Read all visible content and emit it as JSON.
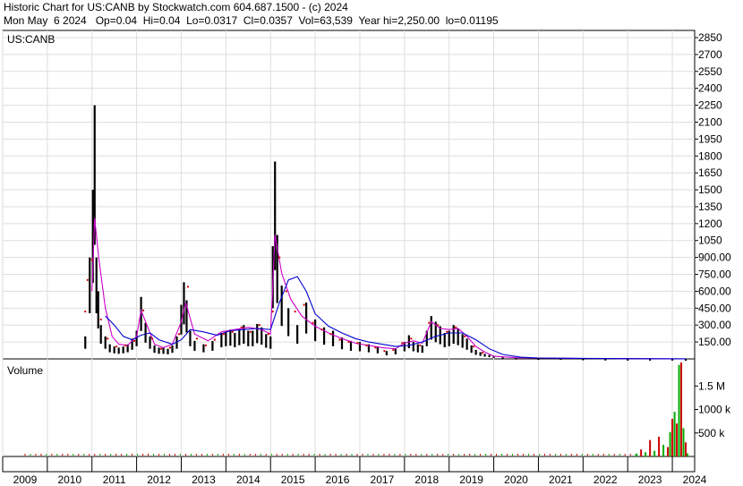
{
  "header": {
    "title": "Historic Chart for US:CANB by Stockwatch.com 604.687.1500 - (c) 2024",
    "summary": "Mon May  6 2024   Op=0.04  Hi=0.04  Lo=0.0317  Cl=0.0357  Vol=63,539  Year hi=2,250.00  lo=0.01195"
  },
  "chart_data": [
    {
      "type": "line",
      "panel_label": "US:CANB",
      "x_tick_labels": [
        "2009",
        "2010",
        "2011",
        "2012",
        "2013",
        "2014",
        "2015",
        "2016",
        "2017",
        "2018",
        "2019",
        "2020",
        "2021",
        "2022",
        "2023",
        "2024"
      ],
      "y_tick_labels": [
        "2850",
        "2700",
        "2550",
        "2400",
        "2250",
        "2100",
        "1950",
        "1800",
        "1650",
        "1500",
        "1350",
        "1200",
        "1050",
        "900.00",
        "750.00",
        "600.00",
        "450.00",
        "300.00",
        "150.00"
      ],
      "y_axis_side": "right",
      "ylim": [
        0,
        2850
      ],
      "grid": true,
      "series": [
        {
          "style": "price-bars",
          "color": "#000000",
          "points": [
            [
              2010.85,
              200
            ],
            [
              2010.95,
              900
            ],
            [
              2011.02,
              1500
            ],
            [
              2011.06,
              2250
            ],
            [
              2011.1,
              900
            ],
            [
              2011.14,
              600
            ],
            [
              2011.2,
              300
            ],
            [
              2011.3,
              200
            ],
            [
              2011.4,
              130
            ],
            [
              2011.5,
              110
            ],
            [
              2011.6,
              100
            ],
            [
              2011.7,
              110
            ],
            [
              2011.8,
              130
            ],
            [
              2011.9,
              180
            ],
            [
              2012.0,
              250
            ],
            [
              2012.1,
              550
            ],
            [
              2012.2,
              320
            ],
            [
              2012.3,
              200
            ],
            [
              2012.4,
              120
            ],
            [
              2012.5,
              100
            ],
            [
              2012.6,
              100
            ],
            [
              2012.7,
              90
            ],
            [
              2012.8,
              120
            ],
            [
              2012.9,
              200
            ],
            [
              2013.0,
              480
            ],
            [
              2013.06,
              680
            ],
            [
              2013.12,
              520
            ],
            [
              2013.2,
              250
            ],
            [
              2013.3,
              160
            ],
            [
              2013.5,
              130
            ],
            [
              2013.7,
              160
            ],
            [
              2013.9,
              230
            ],
            [
              2014.0,
              250
            ],
            [
              2014.1,
              260
            ],
            [
              2014.2,
              230
            ],
            [
              2014.3,
              270
            ],
            [
              2014.4,
              300
            ],
            [
              2014.5,
              250
            ],
            [
              2014.6,
              250
            ],
            [
              2014.7,
              310
            ],
            [
              2014.8,
              280
            ],
            [
              2014.9,
              220
            ],
            [
              2015.0,
              200
            ],
            [
              2015.05,
              1000
            ],
            [
              2015.1,
              1750
            ],
            [
              2015.15,
              1100
            ],
            [
              2015.25,
              650
            ],
            [
              2015.4,
              450
            ],
            [
              2015.6,
              300
            ],
            [
              2015.8,
              500
            ],
            [
              2016.0,
              350
            ],
            [
              2016.2,
              280
            ],
            [
              2016.4,
              250
            ],
            [
              2016.6,
              190
            ],
            [
              2016.8,
              160
            ],
            [
              2017.0,
              150
            ],
            [
              2017.2,
              130
            ],
            [
              2017.4,
              110
            ],
            [
              2017.6,
              70
            ],
            [
              2017.8,
              90
            ],
            [
              2018.0,
              150
            ],
            [
              2018.1,
              210
            ],
            [
              2018.2,
              150
            ],
            [
              2018.3,
              130
            ],
            [
              2018.4,
              120
            ],
            [
              2018.5,
              250
            ],
            [
              2018.6,
              380
            ],
            [
              2018.7,
              330
            ],
            [
              2018.8,
              290
            ],
            [
              2018.9,
              230
            ],
            [
              2019.0,
              250
            ],
            [
              2019.1,
              300
            ],
            [
              2019.2,
              270
            ],
            [
              2019.3,
              220
            ],
            [
              2019.4,
              180
            ],
            [
              2019.5,
              120
            ],
            [
              2019.6,
              80
            ],
            [
              2019.7,
              60
            ],
            [
              2019.8,
              45
            ],
            [
              2019.9,
              35
            ],
            [
              2020.0,
              25
            ],
            [
              2020.2,
              15
            ],
            [
              2020.5,
              10
            ],
            [
              2021.0,
              8
            ],
            [
              2021.5,
              8
            ],
            [
              2022.0,
              4
            ],
            [
              2022.5,
              2
            ],
            [
              2023.0,
              1
            ],
            [
              2023.5,
              1
            ],
            [
              2024.0,
              1
            ],
            [
              2024.3,
              0.04
            ]
          ]
        },
        {
          "style": "moving-average",
          "color": "#cc00cc",
          "points": [
            [
              2011.0,
              600
            ],
            [
              2011.06,
              1250
            ],
            [
              2011.15,
              900
            ],
            [
              2011.3,
              450
            ],
            [
              2011.45,
              200
            ],
            [
              2011.6,
              130
            ],
            [
              2011.8,
              120
            ],
            [
              2012.0,
              200
            ],
            [
              2012.1,
              430
            ],
            [
              2012.25,
              280
            ],
            [
              2012.4,
              130
            ],
            [
              2012.6,
              100
            ],
            [
              2012.8,
              130
            ],
            [
              2013.0,
              330
            ],
            [
              2013.1,
              500
            ],
            [
              2013.3,
              220
            ],
            [
              2013.6,
              160
            ],
            [
              2013.9,
              240
            ],
            [
              2014.2,
              260
            ],
            [
              2014.5,
              280
            ],
            [
              2014.8,
              260
            ],
            [
              2015.0,
              220
            ],
            [
              2015.1,
              1100
            ],
            [
              2015.25,
              760
            ],
            [
              2015.45,
              530
            ],
            [
              2015.7,
              380
            ],
            [
              2016.0,
              290
            ],
            [
              2016.3,
              230
            ],
            [
              2016.6,
              180
            ],
            [
              2016.9,
              140
            ],
            [
              2017.2,
              120
            ],
            [
              2017.5,
              100
            ],
            [
              2017.8,
              90
            ],
            [
              2018.0,
              140
            ],
            [
              2018.2,
              160
            ],
            [
              2018.4,
              140
            ],
            [
              2018.6,
              330
            ],
            [
              2018.8,
              270
            ],
            [
              2019.0,
              260
            ],
            [
              2019.2,
              270
            ],
            [
              2019.4,
              200
            ],
            [
              2019.6,
              110
            ],
            [
              2019.8,
              60
            ],
            [
              2020.0,
              25
            ],
            [
              2020.5,
              10
            ],
            [
              2021.0,
              8
            ],
            [
              2022.0,
              4
            ],
            [
              2023.0,
              2
            ],
            [
              2024.3,
              1
            ]
          ]
        },
        {
          "style": "moving-average",
          "color": "#0000cc",
          "points": [
            [
              2011.3,
              380
            ],
            [
              2011.5,
              300
            ],
            [
              2011.7,
              200
            ],
            [
              2011.9,
              170
            ],
            [
              2012.1,
              210
            ],
            [
              2012.3,
              230
            ],
            [
              2012.5,
              170
            ],
            [
              2012.8,
              130
            ],
            [
              2013.0,
              170
            ],
            [
              2013.2,
              260
            ],
            [
              2013.5,
              240
            ],
            [
              2013.8,
              210
            ],
            [
              2014.1,
              250
            ],
            [
              2014.4,
              260
            ],
            [
              2014.7,
              270
            ],
            [
              2015.0,
              260
            ],
            [
              2015.2,
              500
            ],
            [
              2015.4,
              700
            ],
            [
              2015.6,
              730
            ],
            [
              2015.8,
              600
            ],
            [
              2016.0,
              400
            ],
            [
              2016.3,
              290
            ],
            [
              2016.6,
              230
            ],
            [
              2016.9,
              180
            ],
            [
              2017.2,
              150
            ],
            [
              2017.5,
              130
            ],
            [
              2017.8,
              110
            ],
            [
              2018.1,
              120
            ],
            [
              2018.4,
              150
            ],
            [
              2018.7,
              200
            ],
            [
              2019.0,
              230
            ],
            [
              2019.3,
              230
            ],
            [
              2019.6,
              170
            ],
            [
              2019.9,
              90
            ],
            [
              2020.2,
              40
            ],
            [
              2020.6,
              15
            ],
            [
              2021.0,
              8
            ],
            [
              2022.0,
              5
            ],
            [
              2023.0,
              2
            ],
            [
              2024.3,
              1
            ]
          ]
        },
        {
          "style": "dots",
          "color": "#cc0000",
          "points": [
            [
              2010.85,
              420
            ],
            [
              2010.9,
              700
            ],
            [
              2011.0,
              880
            ],
            [
              2011.2,
              350
            ],
            [
              2011.35,
              180
            ],
            [
              2011.55,
              110
            ],
            [
              2011.75,
              120
            ],
            [
              2011.95,
              160
            ],
            [
              2012.15,
              430
            ],
            [
              2012.35,
              180
            ],
            [
              2012.55,
              90
            ],
            [
              2012.75,
              100
            ],
            [
              2012.95,
              220
            ],
            [
              2013.15,
              640
            ],
            [
              2013.35,
              180
            ],
            [
              2013.55,
              120
            ],
            [
              2013.75,
              170
            ],
            [
              2013.95,
              220
            ],
            [
              2014.15,
              240
            ],
            [
              2014.35,
              280
            ],
            [
              2014.55,
              240
            ],
            [
              2014.75,
              300
            ],
            [
              2014.95,
              220
            ],
            [
              2015.05,
              420
            ],
            [
              2015.2,
              900
            ],
            [
              2015.35,
              600
            ],
            [
              2015.55,
              420
            ],
            [
              2015.75,
              480
            ],
            [
              2015.95,
              320
            ],
            [
              2016.15,
              260
            ],
            [
              2016.35,
              220
            ],
            [
              2016.55,
              170
            ],
            [
              2016.75,
              150
            ],
            [
              2016.95,
              140
            ],
            [
              2017.15,
              120
            ],
            [
              2017.35,
              100
            ],
            [
              2017.55,
              70
            ],
            [
              2017.75,
              80
            ],
            [
              2017.95,
              140
            ],
            [
              2018.15,
              180
            ],
            [
              2018.35,
              120
            ],
            [
              2018.55,
              320
            ],
            [
              2018.75,
              300
            ],
            [
              2018.95,
              240
            ],
            [
              2019.15,
              280
            ],
            [
              2019.35,
              200
            ],
            [
              2019.55,
              110
            ],
            [
              2019.75,
              55
            ]
          ]
        }
      ]
    },
    {
      "type": "bar",
      "panel_label": "Volume",
      "y_tick_labels": [
        "1.5 M",
        "1000 k",
        "500 k"
      ],
      "ylim": [
        0,
        2000000
      ],
      "colors": [
        "#00aa00",
        "#cc0000"
      ],
      "points": [
        [
          2023.2,
          60000
        ],
        [
          2023.3,
          150000
        ],
        [
          2023.4,
          90000
        ],
        [
          2023.5,
          350000
        ],
        [
          2023.6,
          120000
        ],
        [
          2023.7,
          420000
        ],
        [
          2023.8,
          250000
        ],
        [
          2023.9,
          200000
        ],
        [
          2023.95,
          520000
        ],
        [
          2024.0,
          800000
        ],
        [
          2024.05,
          950000
        ],
        [
          2024.1,
          700000
        ],
        [
          2024.15,
          1950000
        ],
        [
          2024.2,
          2000000
        ],
        [
          2024.25,
          600000
        ],
        [
          2024.3,
          300000
        ],
        [
          2024.34,
          63539
        ]
      ]
    }
  ]
}
